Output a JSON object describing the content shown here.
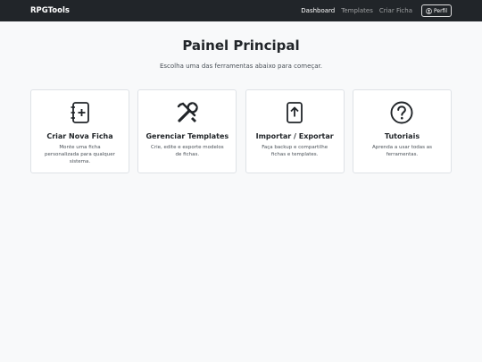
{
  "navbar": {
    "brand": "RPGTools",
    "links": [
      {
        "label": "Dashboard"
      },
      {
        "label": "Templates"
      },
      {
        "label": "Criar Ficha"
      }
    ],
    "profile_label": "Perfil",
    "profile_icon": "user-circle-icon"
  },
  "main": {
    "title": "Painel Principal",
    "subtitle": "Escolha uma das ferramentas abaixo para começar."
  },
  "cards": [
    {
      "icon": "new-sheet-icon",
      "title": "Criar Nova Ficha",
      "text": "Monte uma ficha personalizada para qualquer sistema."
    },
    {
      "icon": "tools-icon",
      "title": "Gerenciar Templates",
      "text": "Crie, edite e exporte modelos de fichas."
    },
    {
      "icon": "upload-icon",
      "title": "Importar / Exportar",
      "text": "Faça backup e compartilhe fichas e templates."
    },
    {
      "icon": "question-circle-icon",
      "title": "Tutoriais",
      "text": "Aprenda a usar todas as ferramentas."
    }
  ],
  "colors": {
    "navbar_bg": "#212529",
    "page_bg": "#f8f9fa",
    "card_border": "#dee2e6",
    "text": "#212529"
  }
}
